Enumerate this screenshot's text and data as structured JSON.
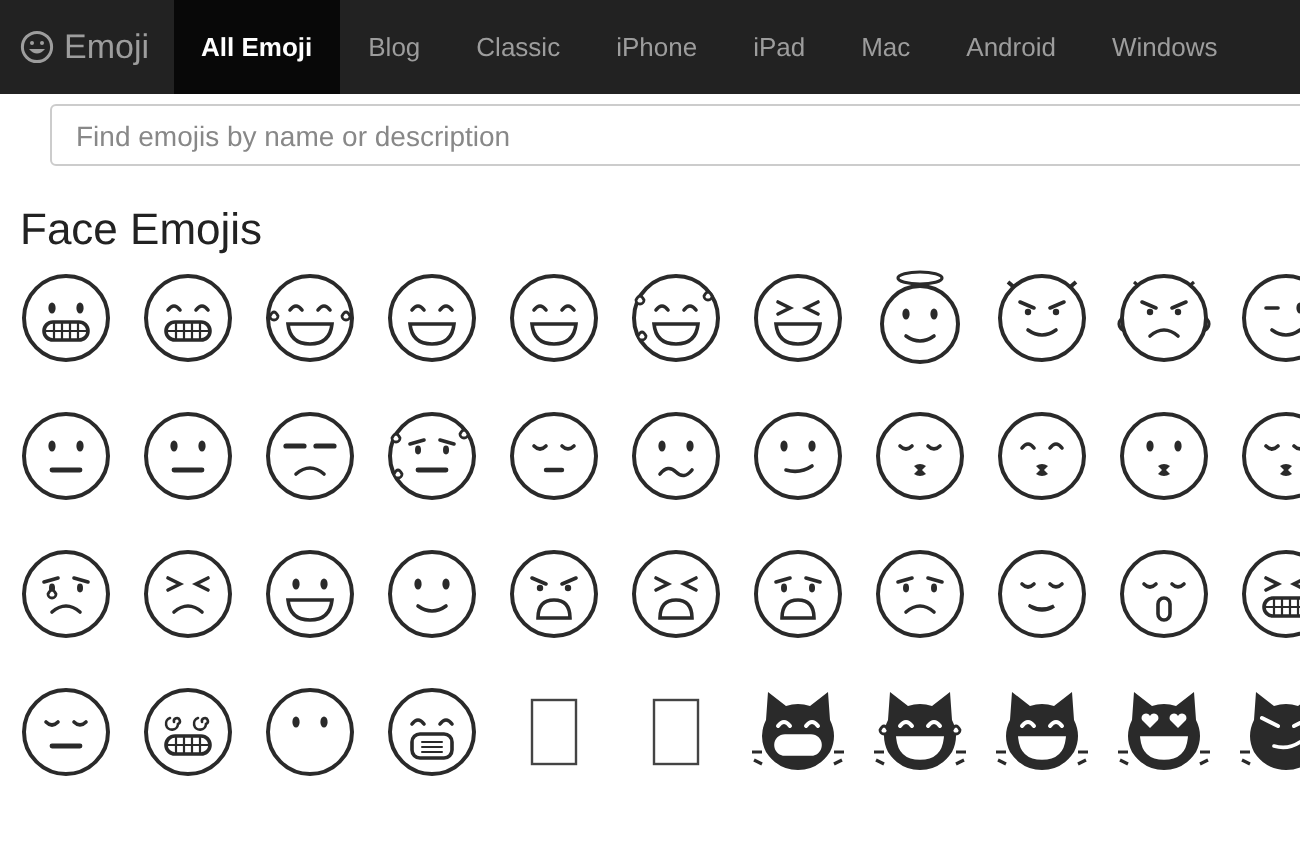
{
  "site": {
    "logo": "Emoji"
  },
  "nav": [
    {
      "label": "All Emoji",
      "selected": true
    },
    {
      "label": "Blog",
      "selected": false
    },
    {
      "label": "Classic",
      "selected": false
    },
    {
      "label": "iPhone",
      "selected": false
    },
    {
      "label": "iPad",
      "selected": false
    },
    {
      "label": "Mac",
      "selected": false
    },
    {
      "label": "Android",
      "selected": false
    },
    {
      "label": "Windows",
      "selected": false
    }
  ],
  "search": {
    "placeholder": "Find emojis by name or description"
  },
  "section": {
    "title": "Face Emojis"
  }
}
